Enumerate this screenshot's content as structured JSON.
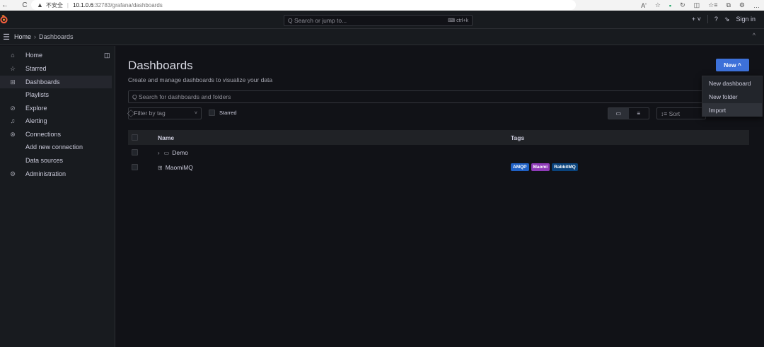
{
  "browser": {
    "back_icon": "←",
    "reload_icon": "C",
    "warning_icon": "▲",
    "insecure_label": "不安全",
    "separator": "|",
    "url_host": "10.1.0.6",
    "url_path": ":32783/grafana/dashboards",
    "toolbar_icons": [
      "Aʹ",
      "☆",
      "▪",
      "↻",
      "◫",
      "☆≡",
      "⧉",
      "⚙",
      "…"
    ]
  },
  "topbar": {
    "search_placeholder": "Search or jump to...",
    "search_shortcut": "⌨ ctrl+k",
    "add_icon": "+ ˅",
    "help_icon": "?",
    "signin_icon": "⇘",
    "signin_label": "Sign in"
  },
  "breadcrumb": {
    "menu_icon": "☰",
    "home": "Home",
    "separator": "›",
    "current": "Dashboards",
    "collapse_icon": "^"
  },
  "sidebar": {
    "dock_icon": "◫",
    "items": [
      {
        "label": "Home",
        "icon": "⌂"
      },
      {
        "label": "Starred",
        "icon": "☆"
      },
      {
        "label": "Dashboards",
        "icon": "⊞"
      },
      {
        "label": "Playlists",
        "icon": ""
      },
      {
        "label": "Explore",
        "icon": "⊘"
      },
      {
        "label": "Alerting",
        "icon": "♫"
      },
      {
        "label": "Connections",
        "icon": "⊗"
      },
      {
        "label": "Add new connection",
        "icon": ""
      },
      {
        "label": "Data sources",
        "icon": ""
      },
      {
        "label": "Administration",
        "icon": "⚙"
      }
    ]
  },
  "main": {
    "title": "Dashboards",
    "subtitle": "Create and manage dashboards to visualize your data",
    "new_button": "New ^",
    "search_placeholder": "Q Search for dashboards and folders",
    "filter_placeholder": "⃟ Filter by tag",
    "filter_chevron": "˅",
    "starred_label": "Starred",
    "view_folder_icon": "▭",
    "view_list_icon": "≡",
    "sort_placeholder": "↕≡ Sort",
    "table": {
      "headers": [
        "Name",
        "Tags"
      ],
      "rows": [
        {
          "expander": "›",
          "icon": "▭",
          "name": "Demo",
          "tags": []
        },
        {
          "expander": "",
          "icon": "⊞",
          "name": "MaomiMQ",
          "tags": [
            {
              "label": "AMQP",
              "color": "#1f60c4"
            },
            {
              "label": "Maomi",
              "color": "#8f3bb8"
            },
            {
              "label": "RabbitMQ",
              "color": "#0a437c"
            }
          ]
        }
      ]
    }
  },
  "new_menu": {
    "items": [
      "New dashboard",
      "New folder",
      "Import"
    ]
  },
  "colors": {
    "accent": "#3d71d9",
    "active_indicator": "#f55f3e",
    "logo": "#f55f3e"
  }
}
